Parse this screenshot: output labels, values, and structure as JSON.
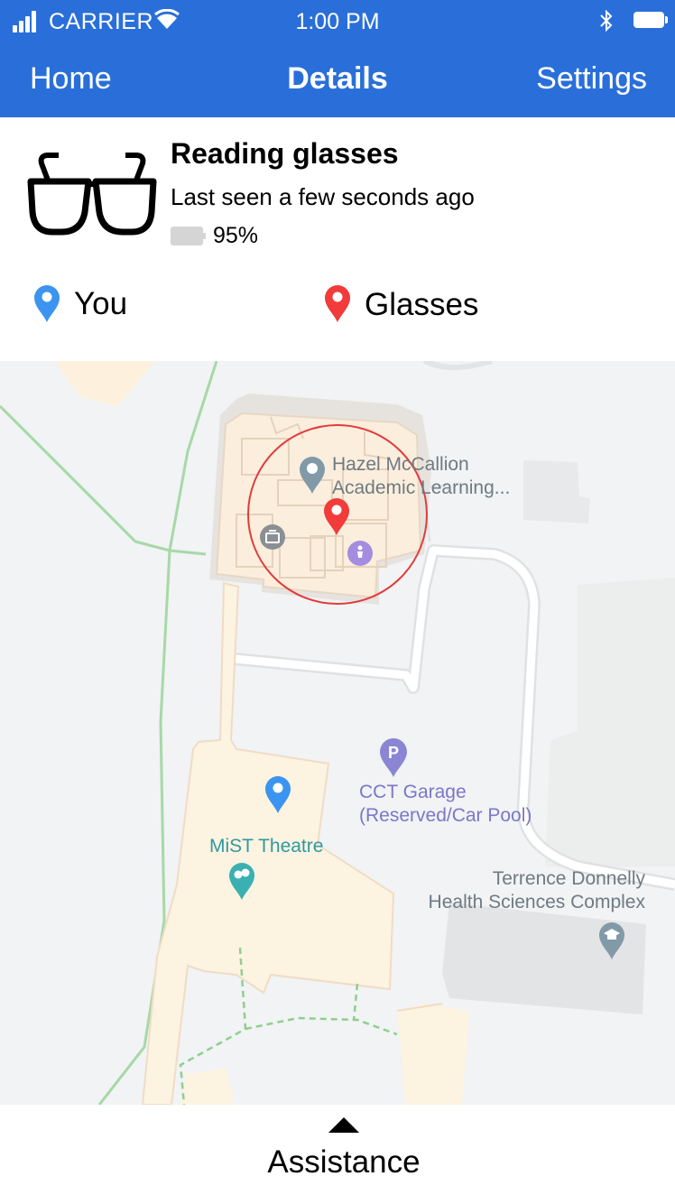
{
  "status_bar": {
    "carrier": "CARRIER",
    "time": "1:00 PM"
  },
  "nav": {
    "left": "Home",
    "title": "Details",
    "right": "Settings"
  },
  "device": {
    "name": "Reading glasses",
    "last_seen": "Last seen a few seconds ago",
    "battery": "95%",
    "icon": "glasses-icon"
  },
  "legend": {
    "you": "You",
    "glasses": "Glasses",
    "you_color": "#3b94f0",
    "glasses_color": "#f23b3b"
  },
  "map": {
    "places": {
      "hazel_line1": "Hazel McCallion",
      "hazel_line2": "Academic Learning...",
      "cct_line1": "CCT Garage",
      "cct_line2": "(Reserved/Car Pool)",
      "mist": "MiST Theatre",
      "terrence_line1": "Terrence Donnelly",
      "terrence_line2": "Health Sciences Complex"
    }
  },
  "bottom": {
    "label": "Assistance"
  },
  "colors": {
    "header": "#2a6fd9",
    "map_bg": "#f1f3f4",
    "building": "#fdf3e1"
  }
}
